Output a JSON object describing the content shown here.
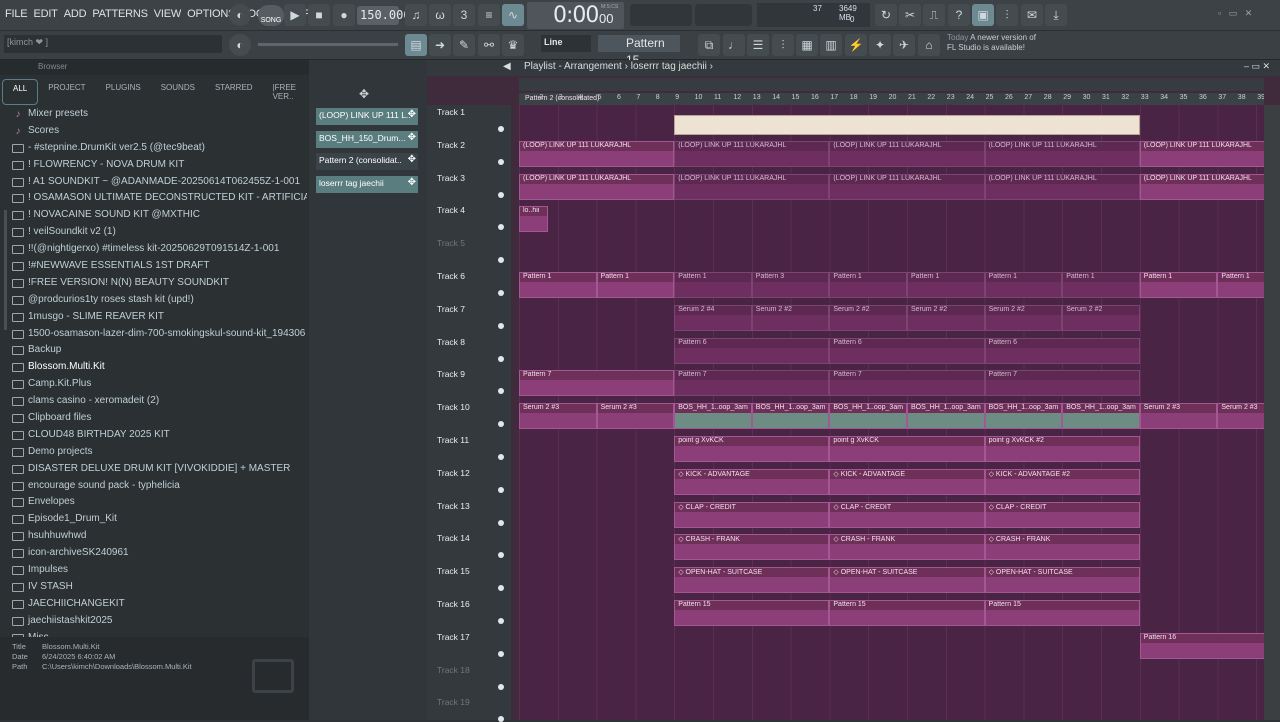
{
  "menu": [
    "FILE",
    "EDIT",
    "ADD",
    "PATTERNS",
    "VIEW",
    "OPTIONS",
    "TOOLS",
    "HELP"
  ],
  "transport": {
    "mode": "SONG",
    "bpm": "150.000",
    "time": "0:00",
    "time_sub": "00",
    "time_unit": "M:S:CS"
  },
  "monitor": {
    "cpu": "37",
    "mem": "3649 MB",
    "voices": "0"
  },
  "hint": "[kimch ❤  ]",
  "snap": "Line",
  "pattern": "Pattern 15",
  "news": {
    "today": "Today",
    "msg": "A newer version of FL Studio is available!"
  },
  "browser": {
    "header": "Browser",
    "tabs": [
      "ALL",
      "PROJECT",
      "PLUGINS",
      "SOUNDS",
      "STARRED",
      "|FREE VER.."
    ],
    "items": [
      {
        "label": "Mixer presets",
        "type": "note"
      },
      {
        "label": "Scores",
        "type": "note"
      },
      {
        "label": "- #stepnine.DrumKit ver2.5 (@tec9beat)",
        "type": "folder"
      },
      {
        "label": "!   FLOWRENCY - NOVA DRUM KIT",
        "type": "folder"
      },
      {
        "label": "!  A1 SOUNDKIT ~ @ADANMADE-20250614T062455Z-1-001",
        "type": "folder"
      },
      {
        "label": "!  OSAMASON ULTIMATE DECONSTRUCTED KIT - ARTIFICIAL",
        "type": "folder"
      },
      {
        "label": "! NOVACAINE SOUND KIT @MXTHIC",
        "type": "folder"
      },
      {
        "label": "! veilSoundkit v2 (1)",
        "type": "folder"
      },
      {
        "label": "!!(@nightigerxo) #timeless kit-20250629T091514Z-1-001",
        "type": "folder"
      },
      {
        "label": "!#NEWWAVE ESSENTIALS 1ST DRAFT",
        "type": "folder"
      },
      {
        "label": "!FREE VERSION! N(N) BEAUTY SOUNDKIT",
        "type": "folder"
      },
      {
        "label": "@prodcurios1ty roses stash kit (upd!)",
        "type": "folder"
      },
      {
        "label": "1musgo - SLIME REAVER KIT",
        "type": "folder"
      },
      {
        "label": "1500-osamason-lazer-dim-700-smokingskul-sound-kit_194306",
        "type": "folder"
      },
      {
        "label": "Backup",
        "type": "folder"
      },
      {
        "label": "Blossom.Multi.Kit",
        "type": "folder",
        "selected": true
      },
      {
        "label": "Camp.Kit.Plus",
        "type": "folder"
      },
      {
        "label": "clams casino - xeromadeit (2)",
        "type": "folder"
      },
      {
        "label": "Clipboard files",
        "type": "folder"
      },
      {
        "label": "CLOUD48 BIRTHDAY 2025 KIT",
        "type": "folder"
      },
      {
        "label": "Demo projects",
        "type": "folder"
      },
      {
        "label": "DISASTER DELUXE DRUM KIT [VIVOKIDDIE] + MASTER",
        "type": "folder"
      },
      {
        "label": "encourage sound pack - typhelicia",
        "type": "folder"
      },
      {
        "label": "Envelopes",
        "type": "folder"
      },
      {
        "label": "Episode1_Drum_Kit",
        "type": "folder"
      },
      {
        "label": "hsuhhuwhwd",
        "type": "folder"
      },
      {
        "label": "icon-archiveSK240961",
        "type": "folder"
      },
      {
        "label": "Impulses",
        "type": "folder"
      },
      {
        "label": "IV STASH",
        "type": "folder"
      },
      {
        "label": "JAECHIICHANGEKIT",
        "type": "folder"
      },
      {
        "label": "jaechiistashkit2025",
        "type": "folder"
      },
      {
        "label": "Misc",
        "type": "folder"
      }
    ],
    "info": {
      "title_k": "Title",
      "title_v": "Blossom.Multi.Kit",
      "date_k": "Date",
      "date_v": "6/24/2025 6:40:02 AM",
      "path_k": "Path",
      "path_v": "C:\\Users\\kimch\\Downloads\\Blossom.Multi.Kit"
    }
  },
  "channels": [
    "(LOOP) LINK UP 111 L..",
    "BOS_HH_150_Drum...",
    "Pattern 2 (consolidat..",
    "loserrr tag jaechii"
  ],
  "playlist": {
    "title": "Playlist - Arrangement",
    "sep": "›",
    "pattern": "loserrr tag jaechii",
    "bars": [
      "2",
      "3",
      "4",
      "5",
      "6",
      "7",
      "8",
      "9",
      "10",
      "11",
      "12",
      "13",
      "14",
      "15",
      "16",
      "17",
      "18",
      "19",
      "20",
      "21",
      "22",
      "23",
      "24",
      "25",
      "26",
      "27",
      "28",
      "29",
      "30",
      "31",
      "32",
      "33",
      "34",
      "35",
      "36",
      "37",
      "38",
      "39"
    ],
    "tracks": [
      "Track 1",
      "Track 2",
      "Track 3",
      "Track 4",
      "Track 5",
      "Track 6",
      "Track 7",
      "Track 8",
      "Track 9",
      "Track 10",
      "Track 11",
      "Track 12",
      "Track 13",
      "Track 14",
      "Track 15",
      "Track 16",
      "Track 17",
      "Track 18",
      "Track 19"
    ],
    "clips": [
      {
        "t": 0,
        "b": 9,
        "w": 24,
        "l": "Pattern 2 (consolidated)",
        "k": "cons"
      },
      {
        "t": 1,
        "b": 1,
        "w": 8,
        "l": "(LOOP) LINK UP 111 LUKARAJHL"
      },
      {
        "t": 1,
        "b": 9,
        "w": 8,
        "l": "(LOOP) LINK UP 111 LUKARAJHL",
        "k": "ghost"
      },
      {
        "t": 1,
        "b": 17,
        "w": 8,
        "l": "(LOOP) LINK UP 111 LUKARAJHL",
        "k": "ghost"
      },
      {
        "t": 1,
        "b": 25,
        "w": 8,
        "l": "(LOOP) LINK UP 111 LUKARAJHL",
        "k": "ghost"
      },
      {
        "t": 1,
        "b": 33,
        "w": 7,
        "l": "(LOOP) LINK UP 111 LUKARAJHL"
      },
      {
        "t": 2,
        "b": 1,
        "w": 8,
        "l": "(LOOP) LINK UP 111 LUKARAJHL"
      },
      {
        "t": 2,
        "b": 9,
        "w": 8,
        "l": "(LOOP) LINK UP 111 LUKARAJHL",
        "k": "ghost"
      },
      {
        "t": 2,
        "b": 17,
        "w": 8,
        "l": "(LOOP) LINK UP 111 LUKARAJHL",
        "k": "ghost"
      },
      {
        "t": 2,
        "b": 25,
        "w": 8,
        "l": "(LOOP) LINK UP 111 LUKARAJHL",
        "k": "ghost"
      },
      {
        "t": 2,
        "b": 33,
        "w": 7,
        "l": "(LOOP) LINK UP 111 LUKARAJHL"
      },
      {
        "t": 3,
        "b": 1,
        "w": 1.5,
        "l": "lo..hii"
      },
      {
        "t": 5,
        "b": 1,
        "w": 4,
        "l": "Pattern 1"
      },
      {
        "t": 5,
        "b": 5,
        "w": 4,
        "l": "Pattern 1"
      },
      {
        "t": 5,
        "b": 9,
        "w": 4,
        "l": "Pattern 1",
        "k": "ghost"
      },
      {
        "t": 5,
        "b": 13,
        "w": 4,
        "l": "Pattern 3",
        "k": "ghost"
      },
      {
        "t": 5,
        "b": 17,
        "w": 4,
        "l": "Pattern 1",
        "k": "ghost"
      },
      {
        "t": 5,
        "b": 21,
        "w": 4,
        "l": "Pattern 1",
        "k": "ghost"
      },
      {
        "t": 5,
        "b": 25,
        "w": 4,
        "l": "Pattern 1",
        "k": "ghost"
      },
      {
        "t": 5,
        "b": 29,
        "w": 4,
        "l": "Pattern 1",
        "k": "ghost"
      },
      {
        "t": 5,
        "b": 33,
        "w": 4,
        "l": "Pattern 1"
      },
      {
        "t": 5,
        "b": 37,
        "w": 3,
        "l": "Pattern 1"
      },
      {
        "t": 6,
        "b": 9,
        "w": 4,
        "l": "Serum 2 #4",
        "k": "ghost"
      },
      {
        "t": 6,
        "b": 13,
        "w": 4,
        "l": "Serum 2 #2",
        "k": "ghost"
      },
      {
        "t": 6,
        "b": 17,
        "w": 4,
        "l": "Serum 2 #2",
        "k": "ghost"
      },
      {
        "t": 6,
        "b": 21,
        "w": 4,
        "l": "Serum 2 #2",
        "k": "ghost"
      },
      {
        "t": 6,
        "b": 25,
        "w": 4,
        "l": "Serum 2 #2",
        "k": "ghost"
      },
      {
        "t": 6,
        "b": 29,
        "w": 4,
        "l": "Serum 2 #2",
        "k": "ghost"
      },
      {
        "t": 7,
        "b": 9,
        "w": 8,
        "l": "Pattern 6",
        "k": "ghost"
      },
      {
        "t": 7,
        "b": 17,
        "w": 8,
        "l": "Pattern 6",
        "k": "ghost"
      },
      {
        "t": 7,
        "b": 25,
        "w": 8,
        "l": "Pattern 6",
        "k": "ghost"
      },
      {
        "t": 8,
        "b": 1,
        "w": 8,
        "l": "Pattern 7"
      },
      {
        "t": 8,
        "b": 9,
        "w": 8,
        "l": "Pattern 7",
        "k": "ghost"
      },
      {
        "t": 8,
        "b": 17,
        "w": 8,
        "l": "Pattern 7",
        "k": "ghost"
      },
      {
        "t": 8,
        "b": 25,
        "w": 8,
        "l": "Pattern 7",
        "k": "ghost"
      },
      {
        "t": 9,
        "b": 1,
        "w": 4,
        "l": "Serum 2 #3"
      },
      {
        "t": 9,
        "b": 5,
        "w": 4,
        "l": "Serum 2 #3"
      },
      {
        "t": 9,
        "b": 9,
        "w": 4,
        "l": "BOS_HH_1..oop_3am",
        "k": "bos"
      },
      {
        "t": 9,
        "b": 13,
        "w": 4,
        "l": "BOS_HH_1..oop_3am",
        "k": "bos"
      },
      {
        "t": 9,
        "b": 17,
        "w": 4,
        "l": "BOS_HH_1..oop_3am",
        "k": "bos"
      },
      {
        "t": 9,
        "b": 21,
        "w": 4,
        "l": "BOS_HH_1..oop_3am",
        "k": "bos"
      },
      {
        "t": 9,
        "b": 25,
        "w": 4,
        "l": "BOS_HH_1..oop_3am",
        "k": "bos"
      },
      {
        "t": 9,
        "b": 29,
        "w": 4,
        "l": "BOS_HH_1..oop_3am",
        "k": "bos"
      },
      {
        "t": 9,
        "b": 33,
        "w": 4,
        "l": "Serum 2 #3"
      },
      {
        "t": 9,
        "b": 37,
        "w": 3,
        "l": "Serum 2 #3"
      },
      {
        "t": 10,
        "b": 9,
        "w": 8,
        "l": "point g XvKCK"
      },
      {
        "t": 10,
        "b": 17,
        "w": 8,
        "l": "point g XvKCK"
      },
      {
        "t": 10,
        "b": 25,
        "w": 8,
        "l": "point g XvKCK #2"
      },
      {
        "t": 11,
        "b": 9,
        "w": 8,
        "l": "◇ KICK - ADVANTAGE"
      },
      {
        "t": 11,
        "b": 17,
        "w": 8,
        "l": "◇ KICK - ADVANTAGE"
      },
      {
        "t": 11,
        "b": 25,
        "w": 8,
        "l": "◇ KICK - ADVANTAGE #2"
      },
      {
        "t": 12,
        "b": 9,
        "w": 8,
        "l": "◇ CLAP - CREDIT"
      },
      {
        "t": 12,
        "b": 17,
        "w": 8,
        "l": "◇ CLAP - CREDIT"
      },
      {
        "t": 12,
        "b": 25,
        "w": 8,
        "l": "◇ CLAP - CREDIT"
      },
      {
        "t": 13,
        "b": 9,
        "w": 8,
        "l": "◇ CRASH - FRANK"
      },
      {
        "t": 13,
        "b": 17,
        "w": 8,
        "l": "◇ CRASH - FRANK"
      },
      {
        "t": 13,
        "b": 25,
        "w": 8,
        "l": "◇ CRASH - FRANK"
      },
      {
        "t": 14,
        "b": 9,
        "w": 8,
        "l": "◇ OPEN-HAT - SUITCASE"
      },
      {
        "t": 14,
        "b": 17,
        "w": 8,
        "l": "◇ OPEN-HAT - SUITCASE"
      },
      {
        "t": 14,
        "b": 25,
        "w": 8,
        "l": "◇ OPEN-HAT - SUITCASE"
      },
      {
        "t": 15,
        "b": 9,
        "w": 8,
        "l": "Pattern 15"
      },
      {
        "t": 15,
        "b": 17,
        "w": 8,
        "l": "Pattern 15"
      },
      {
        "t": 15,
        "b": 25,
        "w": 8,
        "l": "Pattern 15"
      },
      {
        "t": 16,
        "b": 33,
        "w": 7,
        "l": "Pattern 16"
      }
    ]
  }
}
